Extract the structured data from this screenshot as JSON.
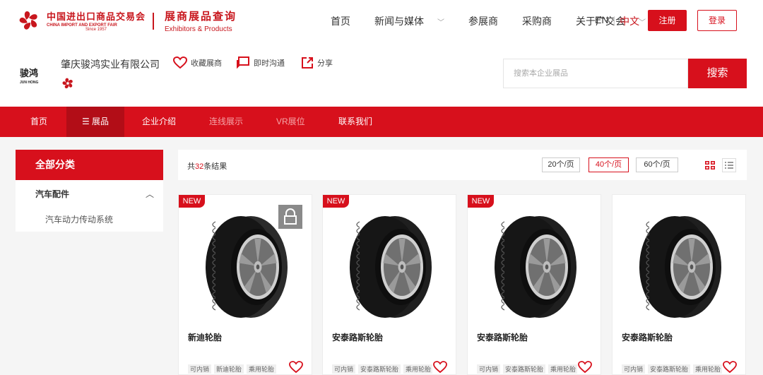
{
  "header": {
    "logo_cn": "中国进出口商品交易会",
    "logo_en": "CHINA IMPORT AND EXPORT FAIR",
    "logo_since": "Since 1957",
    "site_title": "展商展品查询",
    "site_subtitle": "Exhibitors & Products",
    "nav": [
      {
        "label": "首页",
        "has_caret": false
      },
      {
        "label": "新闻与媒体",
        "has_caret": true
      },
      {
        "label": "参展商",
        "has_caret": false
      },
      {
        "label": "采购商",
        "has_caret": false
      },
      {
        "label": "关于广交会",
        "has_caret": true
      }
    ],
    "lang_en": "EN",
    "lang_zh": "中文",
    "register": "注册",
    "login": "登录"
  },
  "company": {
    "logo_cn": "骏鸿",
    "logo_en": "JUN HONG",
    "name": "肇庆骏鸿实业有限公司",
    "actions": [
      {
        "label": "收藏展商",
        "icon": "heart-icon"
      },
      {
        "label": "即时沟通",
        "icon": "chat-icon"
      },
      {
        "label": "分享",
        "icon": "share-icon"
      }
    ],
    "search_placeholder": "搜索本企业展品",
    "search_button": "搜索"
  },
  "menu": {
    "items": [
      "首页",
      "展品",
      "企业介绍",
      "连线展示",
      "VR展位",
      "联系我们"
    ],
    "active": "展品"
  },
  "sidebar": {
    "title": "全部分类",
    "category": "汽车配件",
    "subcategory": "汽车动力传动系统"
  },
  "results": {
    "prefix": "共",
    "count": "32",
    "suffix": "条结果",
    "per_page": [
      "20个/页",
      "40个/页",
      "60个/页"
    ],
    "per_page_active": "40个/页"
  },
  "products": [
    {
      "name": "新迪轮胎",
      "is_new": true,
      "locked": true,
      "tags": [
        "可内销",
        "新迪轮胎",
        "乘用轮胎"
      ]
    },
    {
      "name": "安泰路斯轮胎",
      "is_new": true,
      "locked": false,
      "tags": [
        "可内销",
        "安泰路斯轮胎",
        "乘用轮胎"
      ]
    },
    {
      "name": "安泰路斯轮胎",
      "is_new": true,
      "locked": false,
      "tags": [
        "可内销",
        "安泰路斯轮胎",
        "乘用轮胎"
      ]
    },
    {
      "name": "安泰路斯轮胎",
      "is_new": false,
      "locked": false,
      "tags": [
        "可内销",
        "安泰路斯轮胎",
        "乘用轮胎"
      ]
    }
  ],
  "new_label": "NEW",
  "colors": {
    "brand_red": "#d7101c",
    "menu_active": "#b20d17"
  }
}
